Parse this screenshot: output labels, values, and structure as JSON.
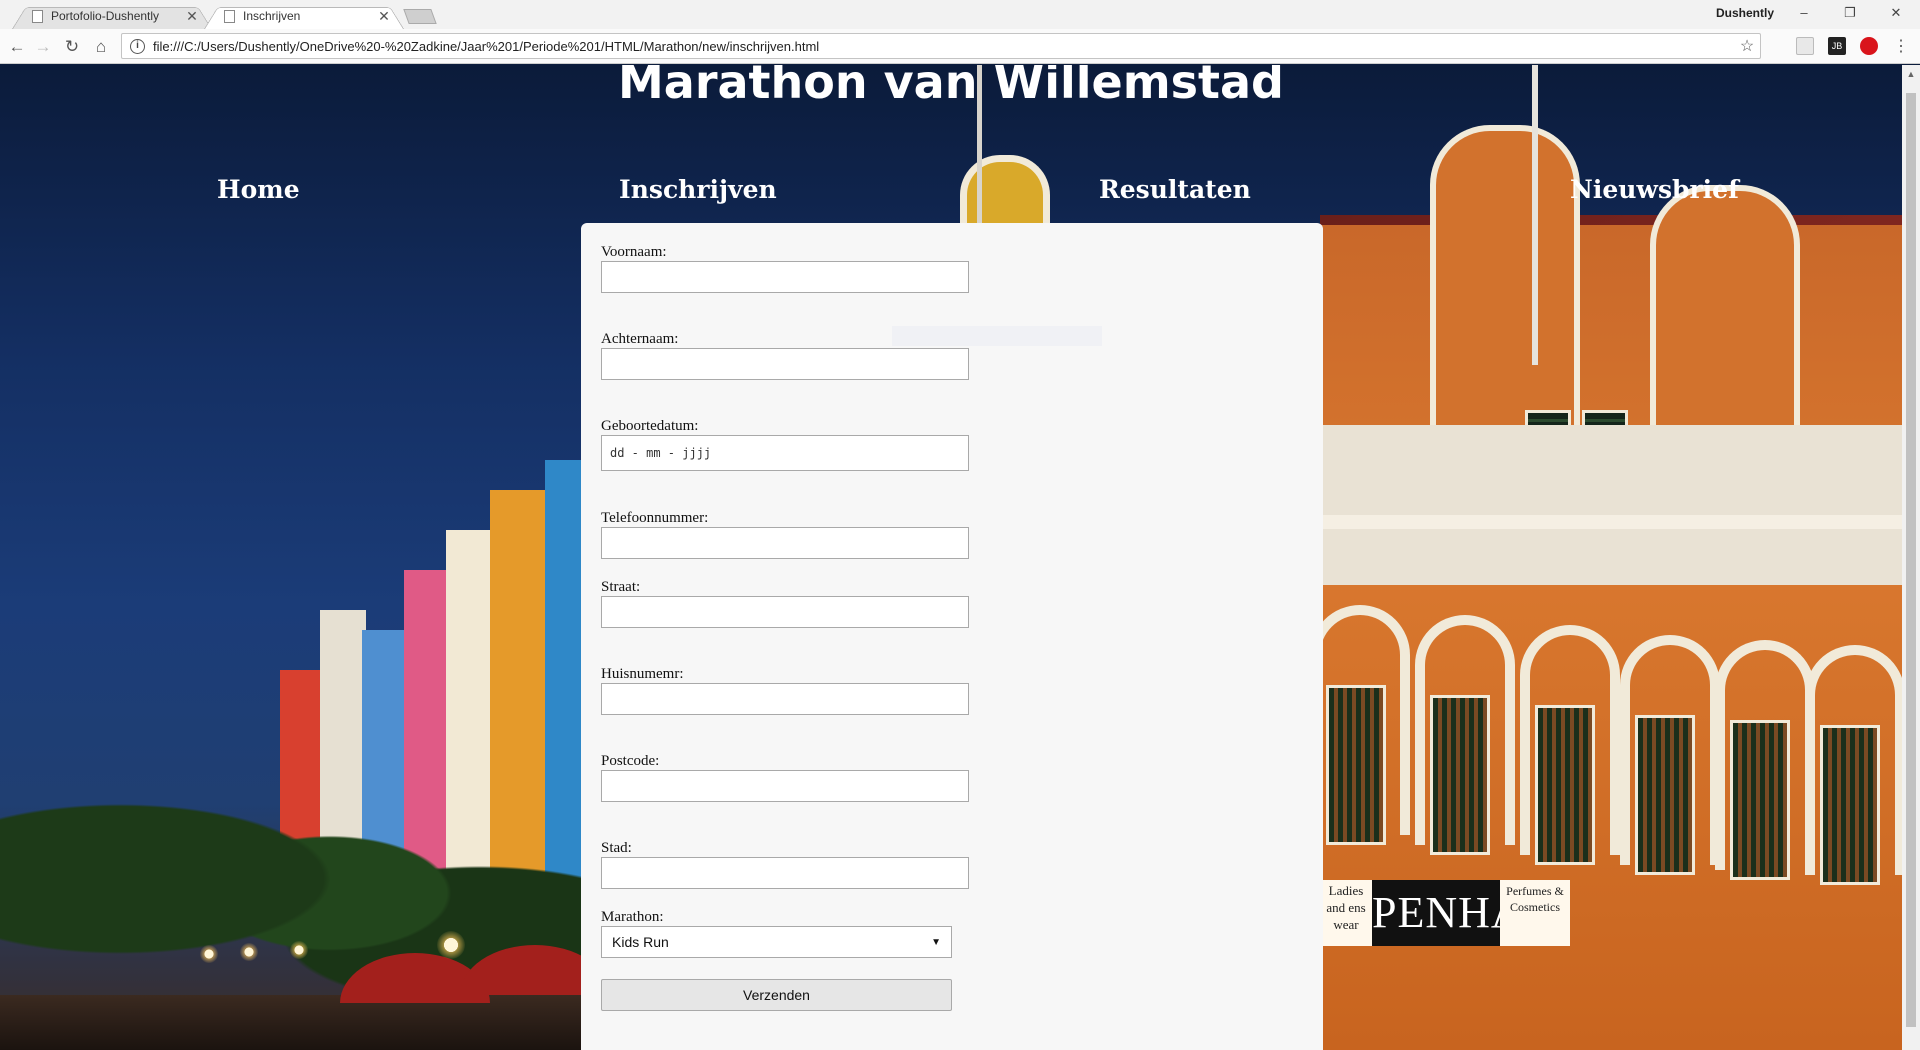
{
  "browser": {
    "tabs": [
      {
        "title": "Portofolio-Dushently",
        "active": false
      },
      {
        "title": "Inschrijven",
        "active": true
      }
    ],
    "profile_name": "Dushently",
    "url": "file:///C:/Users/Dushently/OneDrive%20-%20Zadkine/Jaar%201/Periode%201/HTML/Marathon/new/inschrijven.html",
    "icons": {
      "back": "arrow-left-icon",
      "forward": "arrow-right-icon",
      "reload": "reload-icon",
      "home": "home-icon",
      "info": "info-icon",
      "bookmark": "star-icon",
      "menu": "kebab-menu-icon"
    }
  },
  "site": {
    "title": "Marathon van Willemstad",
    "nav": [
      "Home",
      "Inschrijven",
      "Resultaten",
      "Nieuwsbrief"
    ]
  },
  "form": {
    "fields": [
      {
        "label": "Voornaam:",
        "value": ""
      },
      {
        "label": "Achternaam:",
        "value": ""
      },
      {
        "label": "Geboortedatum:",
        "value": "dd - mm - jjjj"
      },
      {
        "label": "Telefoonnummer:",
        "value": ""
      },
      {
        "label": "Straat:",
        "value": ""
      },
      {
        "label": "Huisnumemr:",
        "value": ""
      },
      {
        "label": "Postcode:",
        "value": ""
      },
      {
        "label": "Stad:",
        "value": ""
      }
    ],
    "marathon": {
      "label": "Marathon:",
      "selected": "Kids Run"
    },
    "submit_label": "Verzenden"
  },
  "background_photo": {
    "sign_main": "PENHA",
    "sign_left": "Ladies and ens wear",
    "sign_right": "Perfumes & Cosmetics"
  },
  "colors": {
    "card": "#f7f7f7",
    "nav_text": "#ffffff",
    "sky": "#142f63"
  }
}
